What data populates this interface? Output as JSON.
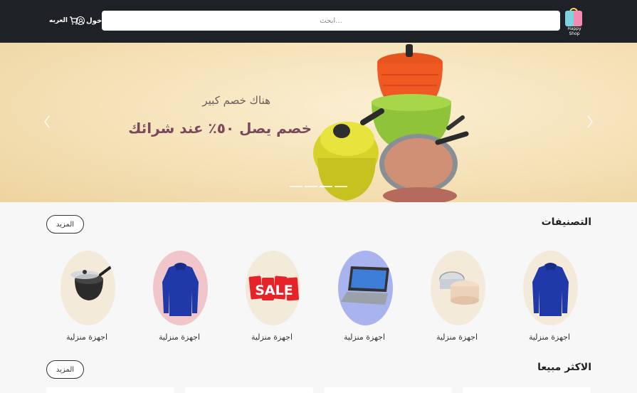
{
  "header": {
    "logo_text": "Happy Shop",
    "search_placeholder": "ابحث...",
    "login_label": "دخول",
    "cart_label": "العربه"
  },
  "banner": {
    "subtitle": "هناك خصم كبير",
    "title": "خصم يصل ٥٠٪ عند شرائك",
    "slide_count": 4,
    "active_slide": 2
  },
  "categories_section": {
    "title": "التصنيفات",
    "more_label": "المزيد",
    "items": [
      {
        "label": "اجهزة منزلية",
        "icon": "sweater-icon",
        "bg": "#f4ead9"
      },
      {
        "label": "اجهزة منزلية",
        "icon": "cosmetic-jar-icon",
        "bg": "#f4ead9"
      },
      {
        "label": "اجهزة منزلية",
        "icon": "laptop-icon",
        "bg": "#a9b4ef"
      },
      {
        "label": "اجهزة منزلية",
        "icon": "sale-tags-icon",
        "bg": "#f4ead9"
      },
      {
        "label": "اجهزة منزلية",
        "icon": "sweater-icon",
        "bg": "#f1c6cb"
      },
      {
        "label": "اجهزة منزلية",
        "icon": "cooking-pot-icon",
        "bg": "#f4ead9"
      }
    ]
  },
  "bestsellers_section": {
    "title": "الاكثر مبيعا",
    "more_label": "المزيد"
  },
  "colors": {
    "header_bg": "#1e2125",
    "banner_title": "#7a4a5c",
    "page_bg": "#f7f7f7"
  }
}
